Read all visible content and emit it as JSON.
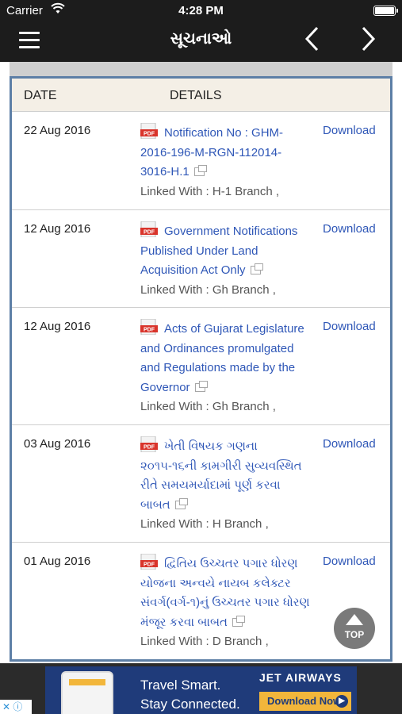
{
  "status_bar": {
    "carrier": "Carrier",
    "time": "4:28 PM"
  },
  "nav": {
    "title": "સૂચનાઓ",
    "prev": "〈",
    "next": "〉"
  },
  "table": {
    "headers": {
      "date": "DATE",
      "details": "DETAILS"
    },
    "download_label": "Download",
    "rows": [
      {
        "date": "22 Aug 2016",
        "title": "Notification No : GHM-2016-196-M-RGN-112014-3016-H.1",
        "linked": "Linked With : H-1 Branch ,"
      },
      {
        "date": "12 Aug 2016",
        "title": "Government Notifications Published Under Land Acquisition Act Only",
        "linked": "Linked With : Gh Branch ,"
      },
      {
        "date": "12 Aug 2016",
        "title": "Acts of Gujarat Legislature and Ordinances promulgated and Regulations made by the Governor",
        "linked": "Linked With : Gh Branch ,"
      },
      {
        "date": "03 Aug 2016",
        "title": "ખેતી વિષયક ગણના ૨૦૧૫-૧૬ની કામગીરી સુવ્યવસ્થિત રીતે સમયમર્યાદામાં પૂર્ણ કરવા બાબત",
        "linked": "Linked With : H Branch ,"
      },
      {
        "date": "01 Aug 2016",
        "title": "દ્વિતિય ઉચ્ચતર પગાર ધોરણ યોજના અન્વયે નાયબ કલેક્ટર સંવર્ગ(વર્ગ-૧)નું ઉચ્ચતર પગાર ધોરણ મંજૂર કરવા બાબત",
        "linked": "Linked With : D Branch ,"
      }
    ]
  },
  "top_button": {
    "label": "TOP"
  },
  "ad": {
    "line1": "Travel Smart.",
    "line2": "Stay Connected.",
    "brand": "JET AIRWAYS",
    "cta": "Download Now",
    "adchoice": "✕ ⓘ"
  },
  "colors": {
    "bar": "#1c1c1c",
    "link": "#2f57b7",
    "table_border": "#5d7fa6",
    "header_bg": "#f4efe6"
  }
}
